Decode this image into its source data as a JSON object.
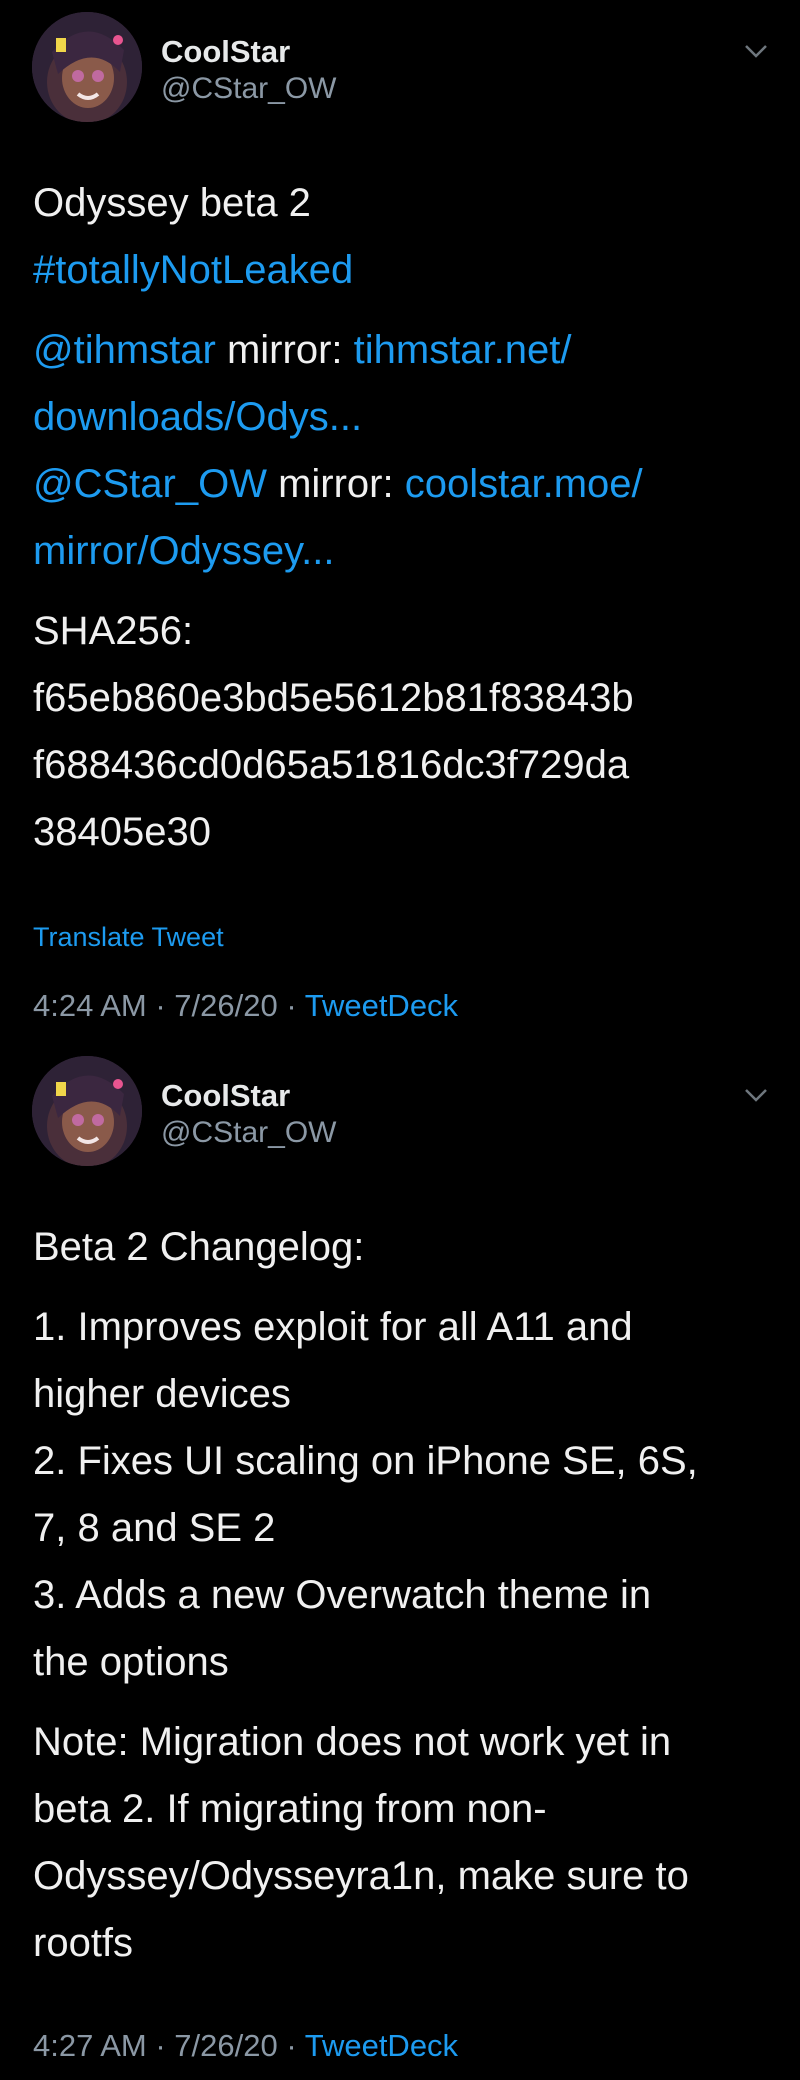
{
  "tweets": [
    {
      "author_name": "CoolStar",
      "author_handle": "@CStar_OW",
      "title": "Odyssey beta 2",
      "hashtag": "#totallyNotLeaked",
      "mirror1_handle": "@tihmstar",
      "mirror_word": " mirror: ",
      "mirror1_url_a": "tihmstar.net/",
      "mirror1_url_b": "downloads/Odys...",
      "mirror2_handle": "@CStar_OW",
      "mirror2_url_a": "coolstar.moe/",
      "mirror2_url_b": "mirror/Odyssey...",
      "sha_label": "SHA256:",
      "sha_line1": "f65eb860e3bd5e5612b81f83843b",
      "sha_line2": "f688436cd0d65a51816dc3f729da",
      "sha_line3": "38405e30",
      "translate": "Translate Tweet",
      "time": "4:24 AM · 7/26/20 · ",
      "source": "TweetDeck"
    },
    {
      "author_name": "CoolStar",
      "author_handle": "@CStar_OW",
      "title": "Beta 2 Changelog:",
      "items": [
        "1. Improves exploit for all A11 and",
        "higher devices",
        "2. Fixes UI scaling on iPhone SE, 6S,",
        "7, 8 and SE 2",
        "3. Adds a new Overwatch theme in",
        "the options"
      ],
      "note": [
        "Note: Migration does not work yet in",
        "beta 2. If migrating from non-",
        "Odyssey/Odysseyra1n, make sure to",
        "rootfs"
      ],
      "time": "4:27 AM · 7/26/20 · ",
      "source": "TweetDeck"
    }
  ],
  "colors": {
    "background": "#000000",
    "link": "#1d9bf0",
    "secondary": "#8b98a5",
    "text": "#f0f0f0"
  },
  "icons": {
    "menu": "chevron-down-icon"
  }
}
